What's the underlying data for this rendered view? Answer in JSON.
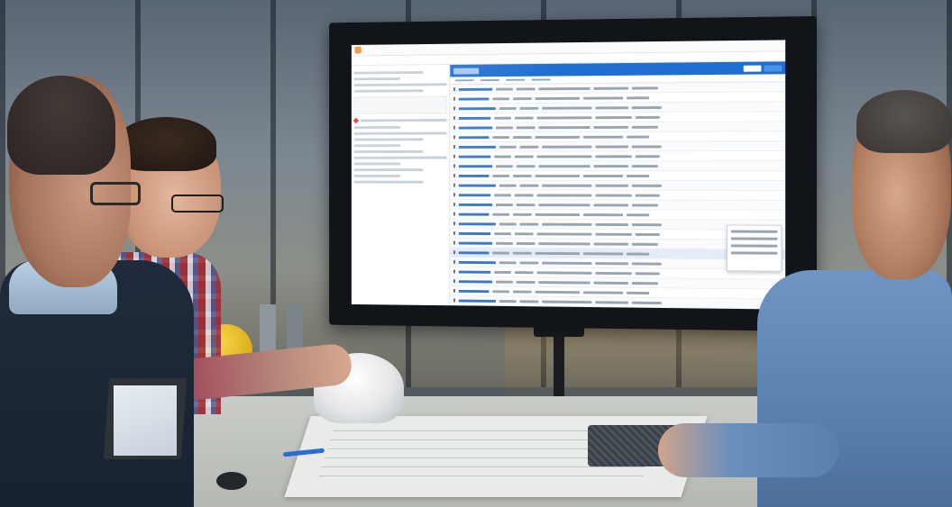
{
  "scene": {
    "description_tag": "meeting-room-with-monitor",
    "colors": {
      "app_header_blue": "#1f6fd1",
      "app_logo_orange": "#f08a2a",
      "alert_red": "#d0312d",
      "left_shirt": "#1f2b3c",
      "right_shirt": "#6f95c4"
    }
  }
}
